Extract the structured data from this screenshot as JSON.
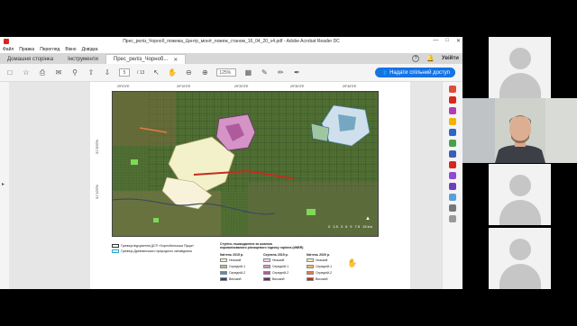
{
  "window": {
    "title": "Прес_реліз_Чорноб_пожежа_Центр_моніт_пожеж_станом_16_04_20_v4.pdf - Adobe Acrobat Reader DC"
  },
  "menu": [
    "Файл",
    "Правка",
    "Перегляд",
    "Вікно",
    "Довідка"
  ],
  "tabs": {
    "home": "Домашня сторінка",
    "tools": "Інструменти",
    "document": "Прес_реліз_Чорноб...",
    "signin": "Увійти"
  },
  "toolbar": {
    "page_current": "5",
    "page_total": "/ 13",
    "zoom": "125%",
    "share_label": "Надати спільний доступ"
  },
  "map": {
    "top_coords": [
      "29°0'0\"E",
      "29°10'0\"E",
      "29°20'0\"E",
      "29°30'0\"E",
      "29°40'0\"E"
    ],
    "left_coords": [
      "51°20'0\"N",
      "51°10'0\"N"
    ],
    "scale_labels": [
      "0",
      "1.5",
      "3",
      "6",
      "9",
      "7.5",
      "15 km"
    ]
  },
  "legend": {
    "boundary_zone": "Границя відчуження ДСП «Чорнобильська Пуща»",
    "boundary_reserve": "Границя Древлянського природного заповідника",
    "title_line1": "Ступінь пошкодження за шкалою",
    "title_line2": "нормалізованого різницевого індексу горіння (dNBR)",
    "col1_header": "Квітень 2015 р.",
    "col2_header": "Серпень 2015 р.",
    "col3_header": "Квітень 2020 р.",
    "levels": [
      "Низький",
      "Середній-1",
      "Середній-2",
      "Високий"
    ],
    "colors_2015_apr": [
      "#f3f1c9",
      "#9ec7a0",
      "#4f8fb0",
      "#2c3f8e"
    ],
    "colors_2015_aug": [
      "#f2d6ea",
      "#d494c6",
      "#b05a9e",
      "#6b2a6e"
    ],
    "colors_2020_apr": [
      "#fbe9c8",
      "#f1b57a",
      "#e47a45",
      "#c62c1f"
    ]
  }
}
